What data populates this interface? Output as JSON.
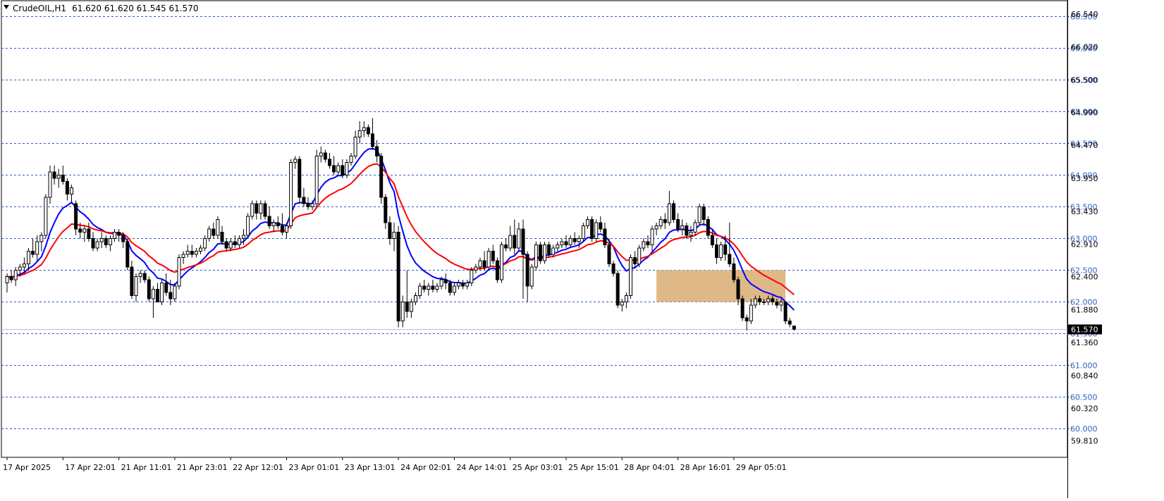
{
  "header": {
    "arrow_icon": "triangle-down-icon",
    "symbol": "CrudeOIL,H1",
    "ohlc": "61.620 61.620 61.545 61.570"
  },
  "colors": {
    "background": "#ffffff",
    "grid": "#2f5fbf",
    "candle": "#000000",
    "ema_fast": "#0000ff",
    "ema_slow": "#ff0000",
    "zone_fill": "#deb887",
    "price_label_bg": "#000000",
    "price_label_text": "#ffffff"
  },
  "chart_data": {
    "type": "candlestick",
    "title": "CrudeOIL,H1",
    "ylim": [
      59.55,
      66.75
    ],
    "grid": true,
    "grid_style": "dashed",
    "grid_levels": [
      60.0,
      60.5,
      61.0,
      61.5,
      62.0,
      62.5,
      63.0,
      63.5,
      64.0,
      64.5,
      65.0,
      65.5,
      66.0,
      66.5
    ],
    "grid_labels": [
      "60.000",
      "60.500",
      "61.000",
      "61.500",
      "62.000",
      "62.500",
      "63.000",
      "63.500",
      "64.000",
      "64.500",
      "65.000",
      "65.500",
      "66.000",
      "66.500"
    ],
    "axis_levels": [
      59.81,
      60.32,
      60.84,
      61.36,
      61.88,
      62.4,
      62.91,
      63.43,
      63.95,
      64.47,
      64.99,
      65.5,
      66.02,
      66.54
    ],
    "axis_labels": [
      "59.810",
      "60.320",
      "60.840",
      "61.360",
      "61.880",
      "62.400",
      "62.910",
      "63.430",
      "63.950",
      "64.470",
      "64.990",
      "65.500",
      "66.020",
      "66.540"
    ],
    "current_price": 61.57,
    "current_price_label": "61.570",
    "x_labels": [
      "17 Apr 2025",
      "17 Apr 22:01",
      "21 Apr 11:01",
      "21 Apr 23:01",
      "22 Apr 12:01",
      "23 Apr 01:01",
      "23 Apr 13:01",
      "24 Apr 02:01",
      "24 Apr 14:01",
      "25 Apr 03:01",
      "25 Apr 15:01",
      "28 Apr 04:01",
      "28 Apr 16:01",
      "29 Apr 05:01"
    ],
    "x_label_bars": [
      0,
      13,
      26,
      39,
      52,
      65,
      78,
      91,
      104,
      117,
      130,
      143,
      156,
      169
    ],
    "zone": {
      "from_bar": 151,
      "to_bar": 181,
      "low": 62.0,
      "high": 62.5
    },
    "candles": [
      [
        62.3,
        62.45,
        62.15,
        62.4
      ],
      [
        62.4,
        62.5,
        62.3,
        62.35
      ],
      [
        62.35,
        62.55,
        62.25,
        62.5
      ],
      [
        62.5,
        62.6,
        62.4,
        62.55
      ],
      [
        62.55,
        62.7,
        62.45,
        62.6
      ],
      [
        62.6,
        62.85,
        62.5,
        62.8
      ],
      [
        62.8,
        63.0,
        62.7,
        62.75
      ],
      [
        62.75,
        63.05,
        62.65,
        62.95
      ],
      [
        62.95,
        63.1,
        62.8,
        63.05
      ],
      [
        63.05,
        63.7,
        63.0,
        63.65
      ],
      [
        63.65,
        64.15,
        63.55,
        64.05
      ],
      [
        64.05,
        64.15,
        63.85,
        63.95
      ],
      [
        63.95,
        64.1,
        63.8,
        64.0
      ],
      [
        64.0,
        64.15,
        63.85,
        63.9
      ],
      [
        63.9,
        63.95,
        63.6,
        63.7
      ],
      [
        63.7,
        63.85,
        63.55,
        63.8
      ],
      [
        63.55,
        63.6,
        63.05,
        63.15
      ],
      [
        63.15,
        63.25,
        63.0,
        63.1
      ],
      [
        63.1,
        63.2,
        62.95,
        63.15
      ],
      [
        63.15,
        63.25,
        62.95,
        63.0
      ],
      [
        63.0,
        63.1,
        62.8,
        62.85
      ],
      [
        62.85,
        63.0,
        62.8,
        62.95
      ],
      [
        62.95,
        63.1,
        62.85,
        63.0
      ],
      [
        63.0,
        63.05,
        62.85,
        62.9
      ],
      [
        62.9,
        63.05,
        62.8,
        63.0
      ],
      [
        63.0,
        63.15,
        62.95,
        63.1
      ],
      [
        63.1,
        63.15,
        62.95,
        63.05
      ],
      [
        63.05,
        63.1,
        62.85,
        62.95
      ],
      [
        62.95,
        63.0,
        62.5,
        62.55
      ],
      [
        62.55,
        62.65,
        62.05,
        62.1
      ],
      [
        62.1,
        62.45,
        62.0,
        62.4
      ],
      [
        62.4,
        62.5,
        62.3,
        62.45
      ],
      [
        62.45,
        62.5,
        62.3,
        62.35
      ],
      [
        62.35,
        62.4,
        62.0,
        62.05
      ],
      [
        62.05,
        62.25,
        61.75,
        62.2
      ],
      [
        62.2,
        62.3,
        62.0,
        62.0
      ],
      [
        62.0,
        62.35,
        61.95,
        62.3
      ],
      [
        62.3,
        62.45,
        62.1,
        62.15
      ],
      [
        62.15,
        62.35,
        61.95,
        62.05
      ],
      [
        62.05,
        62.3,
        62.0,
        62.25
      ],
      [
        62.25,
        62.75,
        62.2,
        62.7
      ],
      [
        62.7,
        62.8,
        62.6,
        62.75
      ],
      [
        62.75,
        62.9,
        62.7,
        62.8
      ],
      [
        62.8,
        62.9,
        62.7,
        62.75
      ],
      [
        62.75,
        62.85,
        62.7,
        62.8
      ],
      [
        62.8,
        62.9,
        62.75,
        62.85
      ],
      [
        62.85,
        63.05,
        62.8,
        63.0
      ],
      [
        63.0,
        63.2,
        62.95,
        63.15
      ],
      [
        63.15,
        63.25,
        63.0,
        63.05
      ],
      [
        63.05,
        63.35,
        63.0,
        63.3
      ],
      [
        63.1,
        63.2,
        62.9,
        62.95
      ],
      [
        62.95,
        63.0,
        62.8,
        62.85
      ],
      [
        62.85,
        63.0,
        62.8,
        62.95
      ],
      [
        62.95,
        63.05,
        62.85,
        62.9
      ],
      [
        62.9,
        63.05,
        62.85,
        63.0
      ],
      [
        63.0,
        63.15,
        62.9,
        63.05
      ],
      [
        63.05,
        63.4,
        63.0,
        63.35
      ],
      [
        63.35,
        63.6,
        63.3,
        63.55
      ],
      [
        63.55,
        63.6,
        63.3,
        63.4
      ],
      [
        63.4,
        63.6,
        63.3,
        63.55
      ],
      [
        63.55,
        63.6,
        63.3,
        63.35
      ],
      [
        63.35,
        63.5,
        63.15,
        63.2
      ],
      [
        63.2,
        63.3,
        63.1,
        63.25
      ],
      [
        63.25,
        63.35,
        63.15,
        63.2
      ],
      [
        63.2,
        63.4,
        63.05,
        63.1
      ],
      [
        63.1,
        63.25,
        63.0,
        63.2
      ],
      [
        63.2,
        64.25,
        63.15,
        64.2
      ],
      [
        64.2,
        64.3,
        64.1,
        64.25
      ],
      [
        64.25,
        64.3,
        63.55,
        63.65
      ],
      [
        63.65,
        63.8,
        63.5,
        63.55
      ],
      [
        63.55,
        63.65,
        63.45,
        63.5
      ],
      [
        63.5,
        63.6,
        63.45,
        63.55
      ],
      [
        63.55,
        64.4,
        63.5,
        64.3
      ],
      [
        64.3,
        64.45,
        64.2,
        64.35
      ],
      [
        64.35,
        64.4,
        64.2,
        64.25
      ],
      [
        64.25,
        64.35,
        64.1,
        64.15
      ],
      [
        64.15,
        64.3,
        64.0,
        64.05
      ],
      [
        64.05,
        64.2,
        64.0,
        64.15
      ],
      [
        64.15,
        64.25,
        63.95,
        64.0
      ],
      [
        64.0,
        64.25,
        63.95,
        64.2
      ],
      [
        64.2,
        64.35,
        64.15,
        64.3
      ],
      [
        64.3,
        64.7,
        64.25,
        64.6
      ],
      [
        64.6,
        64.85,
        64.5,
        64.7
      ],
      [
        64.7,
        64.85,
        64.6,
        64.75
      ],
      [
        64.75,
        64.8,
        64.6,
        64.65
      ],
      [
        64.65,
        64.9,
        64.4,
        64.45
      ],
      [
        64.45,
        64.55,
        64.2,
        64.3
      ],
      [
        64.3,
        64.35,
        63.55,
        63.65
      ],
      [
        63.65,
        63.7,
        63.15,
        63.25
      ],
      [
        63.25,
        63.35,
        62.9,
        63.0
      ],
      [
        63.0,
        63.25,
        62.8,
        63.1
      ],
      [
        63.1,
        63.2,
        61.6,
        61.7
      ],
      [
        61.7,
        62.1,
        61.6,
        62.0
      ],
      [
        62.0,
        62.5,
        61.75,
        61.85
      ],
      [
        61.85,
        62.05,
        61.75,
        62.0
      ],
      [
        62.0,
        62.15,
        61.95,
        62.1
      ],
      [
        62.1,
        62.3,
        62.05,
        62.25
      ],
      [
        62.25,
        62.35,
        62.15,
        62.2
      ],
      [
        62.2,
        62.3,
        62.1,
        62.25
      ],
      [
        62.25,
        62.35,
        62.15,
        62.2
      ],
      [
        62.2,
        62.3,
        62.15,
        62.25
      ],
      [
        62.25,
        62.4,
        62.2,
        62.35
      ],
      [
        62.35,
        62.45,
        62.2,
        62.3
      ],
      [
        62.3,
        62.35,
        62.1,
        62.15
      ],
      [
        62.15,
        62.3,
        62.1,
        62.25
      ],
      [
        62.25,
        62.35,
        62.2,
        62.3
      ],
      [
        62.3,
        62.35,
        62.2,
        62.25
      ],
      [
        62.25,
        62.35,
        62.2,
        62.3
      ],
      [
        62.3,
        62.55,
        62.25,
        62.5
      ],
      [
        62.5,
        62.6,
        62.45,
        62.55
      ],
      [
        62.55,
        62.7,
        62.5,
        62.65
      ],
      [
        62.65,
        62.8,
        62.5,
        62.55
      ],
      [
        62.55,
        62.85,
        62.5,
        62.8
      ],
      [
        62.8,
        62.9,
        62.6,
        62.65
      ],
      [
        62.65,
        62.7,
        62.3,
        62.35
      ],
      [
        62.35,
        62.95,
        62.3,
        62.9
      ],
      [
        62.9,
        63.0,
        62.8,
        62.85
      ],
      [
        62.85,
        63.2,
        62.8,
        63.05
      ],
      [
        63.05,
        63.3,
        62.75,
        62.85
      ],
      [
        62.85,
        63.25,
        62.8,
        63.15
      ],
      [
        63.15,
        63.3,
        62.05,
        62.75
      ],
      [
        62.75,
        62.8,
        62.0,
        62.25
      ],
      [
        62.25,
        62.6,
        62.2,
        62.55
      ],
      [
        62.55,
        62.95,
        62.5,
        62.9
      ],
      [
        62.9,
        62.95,
        62.6,
        62.65
      ],
      [
        62.65,
        62.95,
        62.6,
        62.9
      ],
      [
        62.9,
        62.95,
        62.7,
        62.75
      ],
      [
        62.75,
        62.9,
        62.7,
        62.85
      ],
      [
        62.85,
        62.95,
        62.8,
        62.9
      ],
      [
        62.9,
        63.0,
        62.85,
        62.95
      ],
      [
        62.95,
        63.05,
        62.85,
        62.9
      ],
      [
        62.9,
        63.05,
        62.85,
        63.0
      ],
      [
        63.0,
        63.1,
        62.9,
        62.95
      ],
      [
        62.95,
        63.05,
        62.85,
        63.0
      ],
      [
        63.0,
        63.25,
        62.95,
        63.2
      ],
      [
        63.2,
        63.35,
        63.15,
        63.3
      ],
      [
        63.3,
        63.35,
        62.95,
        63.0
      ],
      [
        63.0,
        63.3,
        62.95,
        63.25
      ],
      [
        63.25,
        63.35,
        63.1,
        63.15
      ],
      [
        63.15,
        63.25,
        62.85,
        62.9
      ],
      [
        62.9,
        63.0,
        62.55,
        62.6
      ],
      [
        62.6,
        62.65,
        62.4,
        62.45
      ],
      [
        62.45,
        62.5,
        61.9,
        61.95
      ],
      [
        61.95,
        62.05,
        61.85,
        62.0
      ],
      [
        62.0,
        62.15,
        61.9,
        62.1
      ],
      [
        62.1,
        62.75,
        62.05,
        62.7
      ],
      [
        62.7,
        62.8,
        62.55,
        62.6
      ],
      [
        62.6,
        62.9,
        62.55,
        62.85
      ],
      [
        62.85,
        63.0,
        62.8,
        62.95
      ],
      [
        62.95,
        63.05,
        62.85,
        62.9
      ],
      [
        62.9,
        63.2,
        62.8,
        63.15
      ],
      [
        63.15,
        63.25,
        63.05,
        63.2
      ],
      [
        63.2,
        63.35,
        63.15,
        63.3
      ],
      [
        63.3,
        63.4,
        63.15,
        63.25
      ],
      [
        63.25,
        63.75,
        63.2,
        63.55
      ],
      [
        63.55,
        63.6,
        63.25,
        63.3
      ],
      [
        63.3,
        63.4,
        63.1,
        63.15
      ],
      [
        63.15,
        63.3,
        63.05,
        63.2
      ],
      [
        63.2,
        63.25,
        63.0,
        63.05
      ],
      [
        63.05,
        63.2,
        62.95,
        63.1
      ],
      [
        63.1,
        63.3,
        63.05,
        63.25
      ],
      [
        63.25,
        63.55,
        63.2,
        63.5
      ],
      [
        63.5,
        63.55,
        63.2,
        63.3
      ],
      [
        63.3,
        63.35,
        63.0,
        63.05
      ],
      [
        63.05,
        63.15,
        62.85,
        62.9
      ],
      [
        62.9,
        63.0,
        62.6,
        62.7
      ],
      [
        62.7,
        62.95,
        62.65,
        62.9
      ],
      [
        62.9,
        63.05,
        62.65,
        62.75
      ],
      [
        62.75,
        63.25,
        62.55,
        62.6
      ],
      [
        62.6,
        62.7,
        62.3,
        62.35
      ],
      [
        62.35,
        62.4,
        61.95,
        62.05
      ],
      [
        62.05,
        62.1,
        61.7,
        61.75
      ],
      [
        61.75,
        61.8,
        61.55,
        61.7
      ],
      [
        61.7,
        62.05,
        61.65,
        61.95
      ],
      [
        61.95,
        62.1,
        61.9,
        62.05
      ],
      [
        62.05,
        62.1,
        61.95,
        62.0
      ],
      [
        62.0,
        62.05,
        61.95,
        62.0
      ],
      [
        62.0,
        62.1,
        61.95,
        62.05
      ],
      [
        62.05,
        62.1,
        61.95,
        62.0
      ],
      [
        62.0,
        62.05,
        61.9,
        61.95
      ],
      [
        61.95,
        62.05,
        61.85,
        62.0
      ],
      [
        62.0,
        62.0,
        61.65,
        61.7
      ],
      [
        61.7,
        61.75,
        61.6,
        61.65
      ],
      [
        61.62,
        61.62,
        61.545,
        61.57
      ]
    ],
    "series": [
      {
        "indicator": "ema",
        "period": 10,
        "color": "#0000ff"
      },
      {
        "indicator": "ema",
        "period": 20,
        "color": "#ff0000"
      }
    ]
  }
}
